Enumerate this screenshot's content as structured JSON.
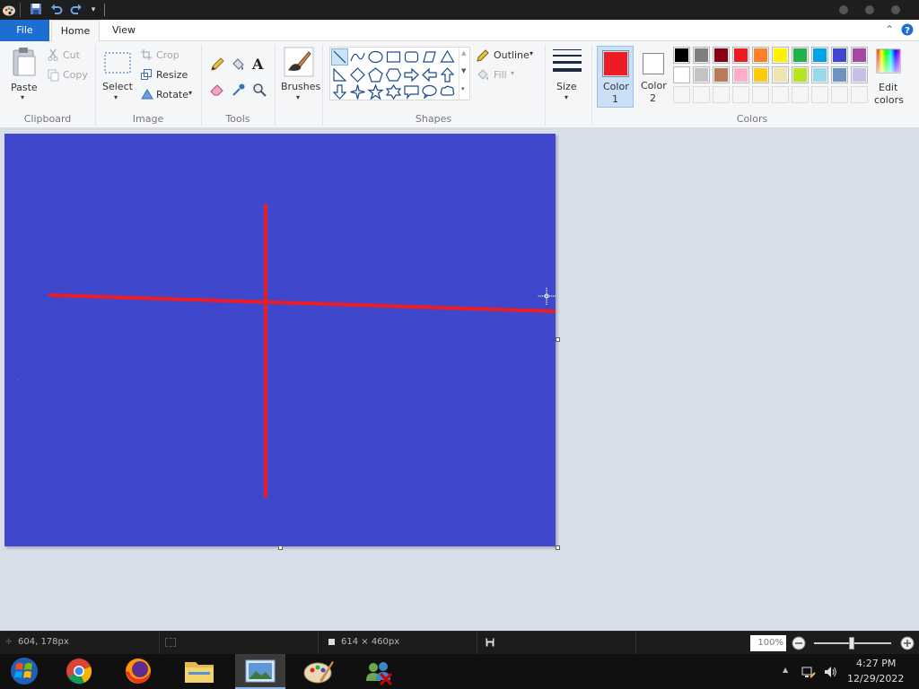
{
  "quick_access": {
    "app_icon": "paint-palette-icon",
    "save_icon": "save-icon",
    "undo_icon": "undo-icon",
    "redo_icon": "redo-icon",
    "customize_icon": "chevron-down-icon"
  },
  "tabs": {
    "file": "File",
    "home": "Home",
    "view": "View"
  },
  "clipboard": {
    "paste": "Paste",
    "cut": "Cut",
    "copy": "Copy",
    "group": "Clipboard"
  },
  "image": {
    "select": "Select",
    "crop": "Crop",
    "resize": "Resize",
    "rotate": "Rotate",
    "group": "Image"
  },
  "tools": {
    "group": "Tools",
    "text_glyph": "A"
  },
  "brushes": {
    "label": "Brushes"
  },
  "shapes": {
    "outline": "Outline",
    "fill": "Fill",
    "group": "Shapes"
  },
  "size": {
    "label": "Size"
  },
  "colors": {
    "color1_label": "Color",
    "color1_num": "1",
    "color2_label": "Color",
    "color2_num": "2",
    "edit_label": "Edit",
    "edit_label2": "colors",
    "group": "Colors",
    "color1": "#ed1c24",
    "color2": "#ffffff",
    "row1": [
      "#000000",
      "#7f7f7f",
      "#880015",
      "#ed1c24",
      "#ff7f27",
      "#fff200",
      "#22b14c",
      "#00a2e8",
      "#3f48cc",
      "#a349a4"
    ],
    "row2": [
      "#ffffff",
      "#c3c3c3",
      "#b97a57",
      "#ffaec9",
      "#ffc90e",
      "#efe4b0",
      "#b5e61d",
      "#99d9ea",
      "#7092be",
      "#c8bfe7"
    ]
  },
  "canvas": {
    "background": "#3f48cc",
    "stroke_color": "#ed1c24"
  },
  "status": {
    "cursor_pos": "604, 178px",
    "canvas_size": "614 × 460px",
    "zoom": "100%"
  },
  "taskbar": {
    "time": "4:27 PM",
    "date": "12/29/2022"
  }
}
